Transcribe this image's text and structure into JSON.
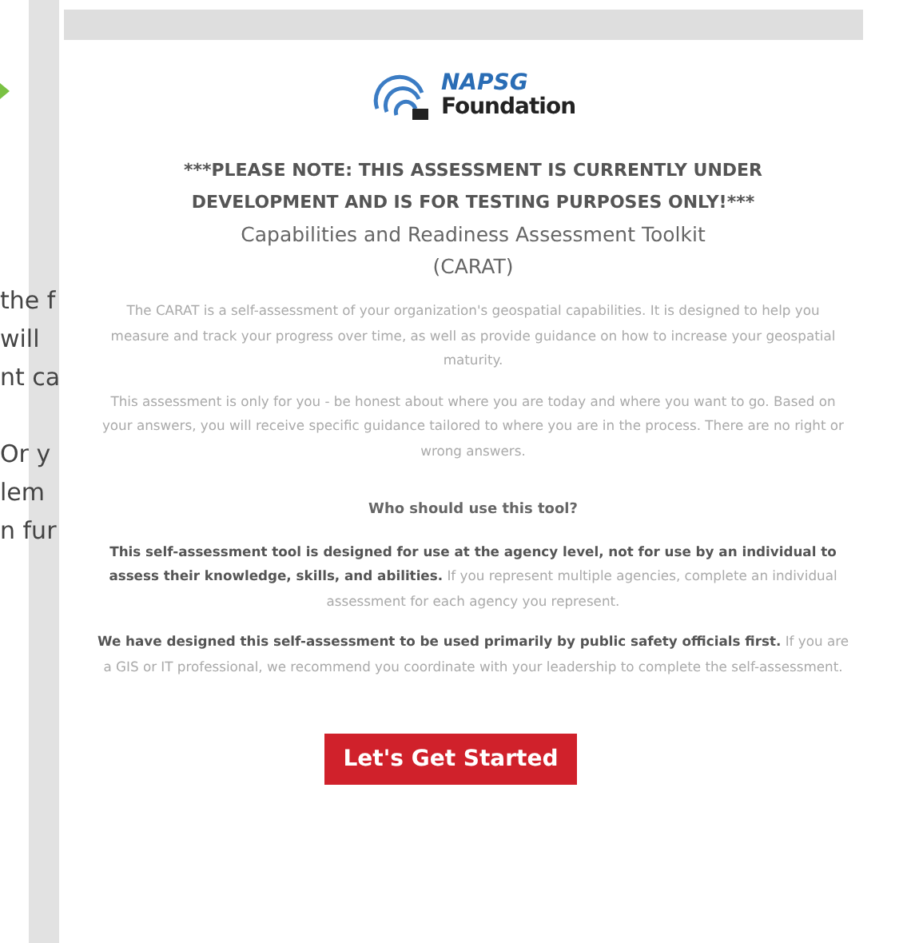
{
  "background_page": {
    "paragraphs": [
      [
        "the f",
        "will",
        "nt ca"
      ],
      [
        "Or y",
        "lem",
        "n fur"
      ]
    ]
  },
  "modal": {
    "logo": {
      "line_1": "NAPSG",
      "line_2": "Foundation"
    },
    "notice": "***PLEASE NOTE: THIS ASSESSMENT IS CURRENTLY UNDER DEVELOPMENT AND IS FOR TESTING PURPOSES ONLY!***",
    "title": "Capabilities and Readiness Assessment Toolkit",
    "acronym": "(CARAT)",
    "paragraphs": [
      {
        "kind": "plain",
        "text": "The CARAT is a self-assessment of your organization's geospatial capabilities. It is designed to help you measure and track your progress over time, as well as provide guidance on how to increase your geospatial maturity."
      },
      {
        "kind": "plain",
        "text": "This assessment is only for you - be honest about where you are today and where you want to go. Based on your answers, you will receive specific guidance tailored to where you are in the process. There are no right or wrong answers."
      },
      {
        "kind": "heading",
        "text": "Who should use this tool?"
      },
      {
        "kind": "rich",
        "text": "**This self-assessment tool is designed for use at the agency level, not for use by an individual to assess their knowledge, skills, and abilities.** If you represent multiple agencies, complete an individual assessment for each agency you represent."
      },
      {
        "kind": "rich",
        "text": "**We have designed this self-assessment to be used primarily by public safety officials first.** If you are a GIS or IT professional, we recommend you coordinate with your leadership to complete the self-assessment."
      }
    ],
    "start_button": "Let's Get Started"
  }
}
